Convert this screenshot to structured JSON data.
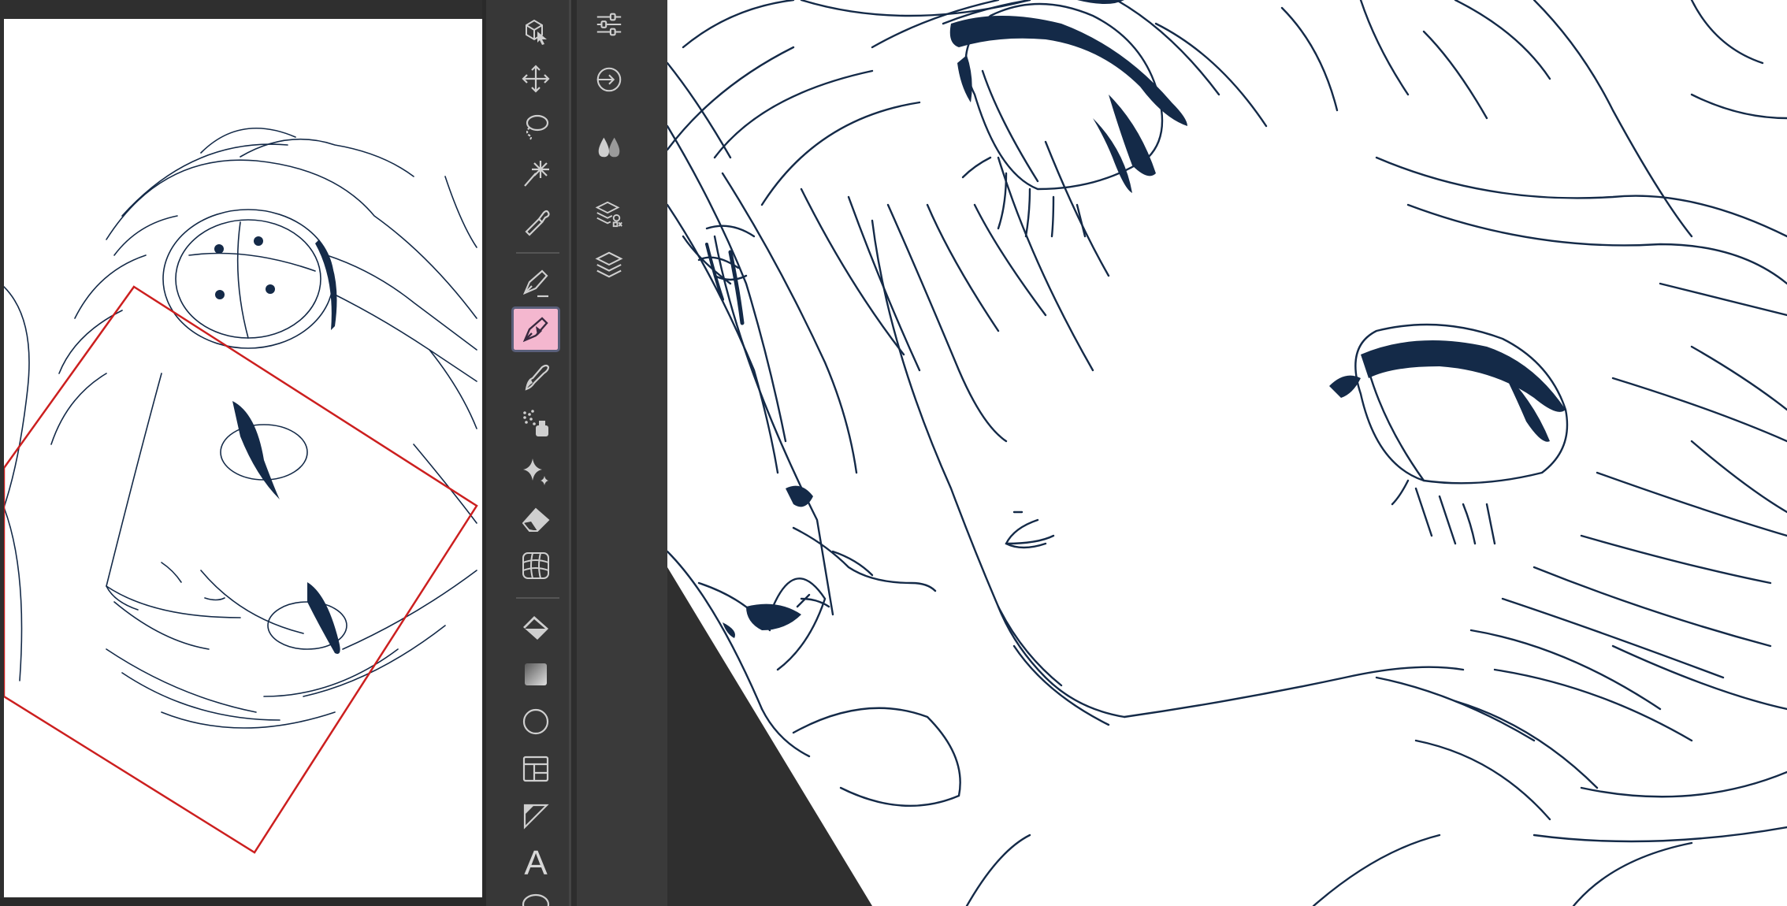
{
  "app": {
    "accent_color": "#f4b7cf",
    "line_color": "#142a48",
    "rotation_frame_color": "#cc1f1f"
  },
  "tool_palette": {
    "tools": [
      {
        "icon": "object-select-icon",
        "active": false
      },
      {
        "icon": "move-icon",
        "active": false
      },
      {
        "icon": "lasso-icon",
        "active": false
      },
      {
        "icon": "magic-wand-icon",
        "active": false
      },
      {
        "icon": "eyedropper-icon",
        "active": false
      },
      {
        "icon": "pen-icon",
        "active": false
      },
      {
        "icon": "pencil-icon",
        "active": true
      },
      {
        "icon": "brush-icon",
        "active": false
      },
      {
        "icon": "airbrush-icon",
        "active": false
      },
      {
        "icon": "sparkle-decoration-icon",
        "active": false
      },
      {
        "icon": "eraser-icon",
        "active": false
      },
      {
        "icon": "blend-grid-icon",
        "active": false
      },
      {
        "icon": "fill-bucket-icon",
        "active": false
      },
      {
        "icon": "gradient-icon",
        "active": false
      },
      {
        "icon": "shape-circle-icon",
        "active": false
      },
      {
        "icon": "frame-border-icon",
        "active": false
      },
      {
        "icon": "ruler-icon",
        "active": false
      },
      {
        "icon": "text-tool-icon",
        "active": false,
        "glyph": "A"
      }
    ]
  },
  "panel_tabs": [
    {
      "icon": "tool-property-icon"
    },
    {
      "icon": "sub-tool-icon"
    },
    {
      "icon": "color-drops-icon"
    },
    {
      "icon": "layer-property-icon"
    },
    {
      "icon": "layers-icon"
    }
  ]
}
